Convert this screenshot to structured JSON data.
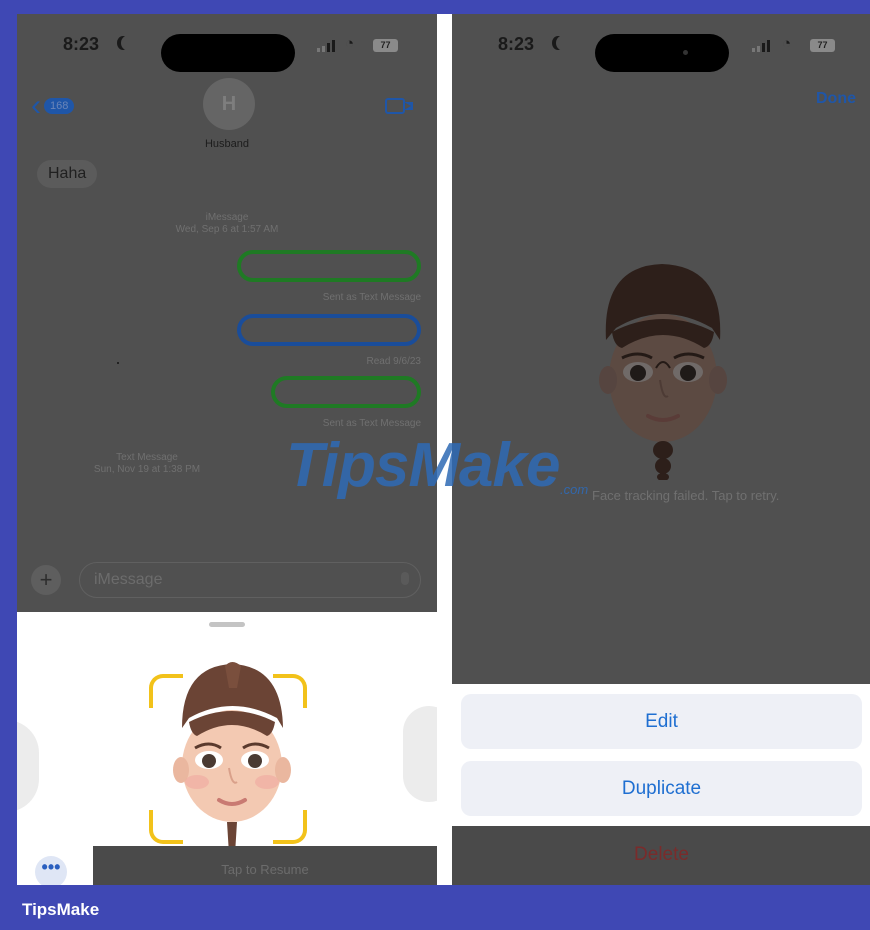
{
  "colors": {
    "frame": "#3f48b4",
    "ios_blue": "#1f6fd1",
    "sent_green_border": "#1f7a24",
    "read_blue_border": "#1a4d9a",
    "scan_yellow": "#f2c21a",
    "delete_red": "#7a2b2b",
    "dim_overlay": "#505050"
  },
  "left_screen": {
    "status": {
      "time": "8:23",
      "battery": "77"
    },
    "header": {
      "back_count": "168",
      "avatar_initial": "H",
      "contact_name": "Husband"
    },
    "messages": {
      "incoming_text": "Haha",
      "meta_imessage": {
        "line1": "iMessage",
        "line2": "Wed, Sep 6 at 1:57 AM"
      },
      "bubble1_note": "Sent as Text Message",
      "bubble2_note": "Read 9/6/23",
      "bubble3_note": "Sent as Text Message",
      "meta_text": {
        "line1": "Text Message",
        "line2": "Sun, Nov 19 at 1:38 PM"
      }
    },
    "input": {
      "placeholder": "iMessage"
    },
    "sheet": {
      "more_label": "•••",
      "toast": "Tap to Resume"
    }
  },
  "right_screen": {
    "status": {
      "time": "8:23",
      "battery": "77"
    },
    "done_label": "Done",
    "tracking_message": "Face tracking failed. Tap to retry.",
    "actions": {
      "edit": "Edit",
      "duplicate": "Duplicate",
      "delete": "Delete"
    }
  },
  "watermark": {
    "brand": "TipsMake",
    "domain": ".com"
  },
  "footer": {
    "brand": "TipsMake"
  }
}
